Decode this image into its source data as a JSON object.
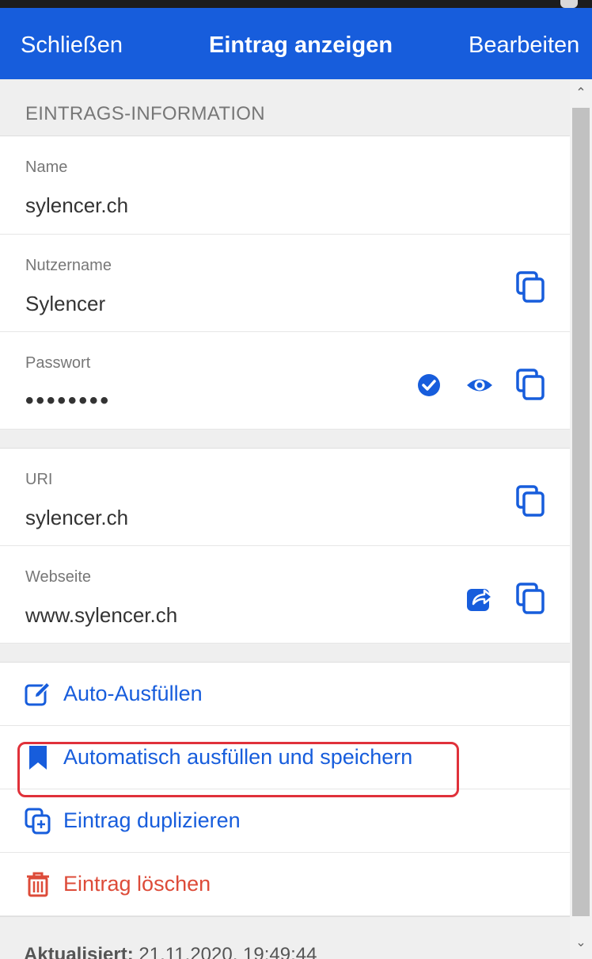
{
  "header": {
    "close_label": "Schließen",
    "title": "Eintrag anzeigen",
    "edit_label": "Bearbeiten",
    "color": "#175ddc"
  },
  "section": {
    "title": "EINTRAGS-INFORMATION"
  },
  "fields": {
    "name": {
      "label": "Name",
      "value": "sylencer.ch"
    },
    "username": {
      "label": "Nutzername",
      "value": "Sylencer",
      "icons": [
        "copy-icon"
      ]
    },
    "password": {
      "label": "Passwort",
      "value": "••••••••",
      "icons": [
        "check-circle-icon",
        "eye-icon",
        "copy-icon"
      ]
    },
    "uri": {
      "label": "URI",
      "value": "sylencer.ch",
      "icons": [
        "copy-icon"
      ]
    },
    "website": {
      "label": "Webseite",
      "value": "www.sylencer.ch",
      "icons": [
        "share-icon",
        "copy-icon"
      ]
    }
  },
  "actions": [
    {
      "label": "Auto-Ausfüllen",
      "icon": "edit-icon"
    },
    {
      "label": "Automatisch ausfüllen und speichern",
      "icon": "bookmark-icon",
      "highlighted": true
    },
    {
      "label": "Eintrag duplizieren",
      "icon": "duplicate-icon"
    },
    {
      "label": "Eintrag löschen",
      "icon": "trash-icon",
      "color": "#dd4b39"
    }
  ],
  "footer": {
    "updated_label": "Aktualisiert:",
    "updated_value": "21.11.2020, 19:49:44"
  }
}
